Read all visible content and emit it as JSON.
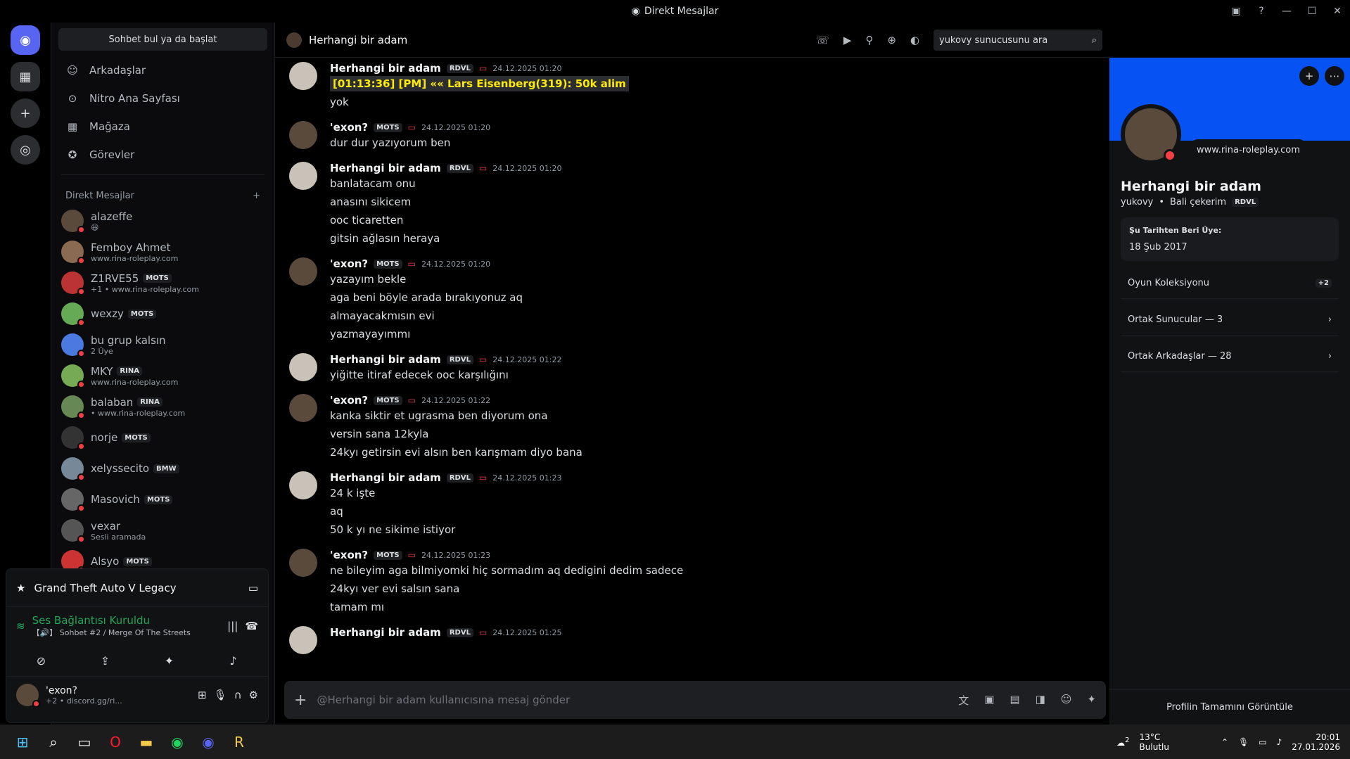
{
  "window": {
    "title": "Direkt Mesajlar"
  },
  "sidebar": {
    "search": "Sohbet bul ya da başlat",
    "nav": [
      {
        "label": "Arkadaşlar",
        "icon": "friends-icon"
      },
      {
        "label": "Nitro Ana Sayfası",
        "icon": "nitro-icon"
      },
      {
        "label": "Mağaza",
        "icon": "shop-icon"
      },
      {
        "label": "Görevler",
        "icon": "quests-icon"
      }
    ],
    "dm_header": "Direkt Mesajlar",
    "dms": [
      {
        "name": "alazeffe",
        "sub": "😄",
        "tag": ""
      },
      {
        "name": "Femboy Ahmet",
        "sub": "www.rina-roleplay.com",
        "tag": ""
      },
      {
        "name": "Z1RVE55",
        "sub": "+1 • www.rina-roleplay.com",
        "tag": "MOTS"
      },
      {
        "name": "wexzy",
        "sub": "",
        "tag": "MOTS"
      },
      {
        "name": "bu grup kalsın",
        "sub": "2 Üye",
        "tag": ""
      },
      {
        "name": "MKY",
        "sub": "www.rina-roleplay.com",
        "tag": "RINA"
      },
      {
        "name": "balaban",
        "sub": "• www.rina-roleplay.com",
        "tag": "RINA"
      },
      {
        "name": "norje",
        "sub": "",
        "tag": "MOTS"
      },
      {
        "name": "xelyssecito",
        "sub": "",
        "tag": "BMW"
      },
      {
        "name": "Masovich",
        "sub": "",
        "tag": "MOTS"
      },
      {
        "name": "vexar",
        "sub": "Sesli aramada",
        "tag": ""
      },
      {
        "name": "Alsyo",
        "sub": "",
        "tag": "MOTS"
      }
    ],
    "game": "Grand Theft Auto V Legacy",
    "voice_status": "Ses Bağlantısı Kuruldu",
    "voice_channel": "【🔊】 Sohbet #2 / Merge Of The Streets",
    "user": {
      "name": "'exon?",
      "sub": "+2 • discord.gg/ri..."
    }
  },
  "channel": {
    "title": "Herhangi bir adam",
    "search": "yukovy sunucusunu ara"
  },
  "messages": [
    {
      "author": "Herhangi bir adam",
      "tag": "RDVL",
      "time": "24.12.2025 01:20",
      "highlight": "[01:13:36] [PM] «« Lars Eisenberg(319): 50k alim",
      "lines": [
        "yok"
      ]
    },
    {
      "author": "'exon?",
      "tag": "MOTS",
      "time": "24.12.2025 01:20",
      "highlight": "",
      "lines": [
        "dur dur yazıyorum ben"
      ]
    },
    {
      "author": "Herhangi bir adam",
      "tag": "RDVL",
      "time": "24.12.2025 01:20",
      "highlight": "",
      "lines": [
        "banlatacam onu",
        "anasını sikicem",
        "ooc ticaretten",
        "gitsin ağlasın heraya"
      ]
    },
    {
      "author": "'exon?",
      "tag": "MOTS",
      "time": "24.12.2025 01:20",
      "highlight": "",
      "lines": [
        "yazayım bekle",
        "aga beni böyle arada bırakıyonuz aq",
        "almayacakmısın evi",
        "yazmayayımmı"
      ]
    },
    {
      "author": "Herhangi bir adam",
      "tag": "RDVL",
      "time": "24.12.2025 01:22",
      "highlight": "",
      "lines": [
        "yiğitte itiraf edecek ooc karşılığını"
      ]
    },
    {
      "author": "'exon?",
      "tag": "MOTS",
      "time": "24.12.2025 01:22",
      "highlight": "",
      "lines": [
        "kanka siktir et ugrasma ben diyorum ona",
        "versin sana 12kyla",
        "24kyı getirsin evi alsın ben karışmam diyo bana"
      ]
    },
    {
      "author": "Herhangi bir adam",
      "tag": "RDVL",
      "time": "24.12.2025 01:23",
      "highlight": "",
      "lines": [
        "24 k işte",
        "aq",
        "50 k yı ne sikime istiyor"
      ]
    },
    {
      "author": "'exon?",
      "tag": "MOTS",
      "time": "24.12.2025 01:23",
      "highlight": "",
      "lines": [
        "ne bileyim aga bilmiyomki hiç sormadım aq dedigini dedim sadece",
        "24kyı ver evi salsın sana",
        "tamam mı"
      ]
    },
    {
      "author": "Herhangi bir adam",
      "tag": "RDVL",
      "time": "24.12.2025 01:25",
      "highlight": "",
      "lines": []
    }
  ],
  "composer": {
    "placeholder": "@Herhangi bir adam kullanıcısına mesaj gönder"
  },
  "profile": {
    "bubble": "www.rina-roleplay.com",
    "name": "Herhangi bir adam",
    "username": "yukovy",
    "pronoun": "Bali çekerim",
    "tag": "RDVL",
    "member_since_label": "Şu Tarihten Beri Üye:",
    "member_since": "18 Şub 2017",
    "games": "Oyun Koleksiyonu",
    "games_more": "+2",
    "servers": "Ortak Sunucular — 3",
    "friends": "Ortak Arkadaşlar — 28",
    "full": "Profilin Tamamını Görüntüle"
  },
  "tray": {
    "temp": "13°C",
    "weather": "Bulutlu",
    "badge": "2",
    "time": "20:01",
    "date": "27.01.2026"
  }
}
